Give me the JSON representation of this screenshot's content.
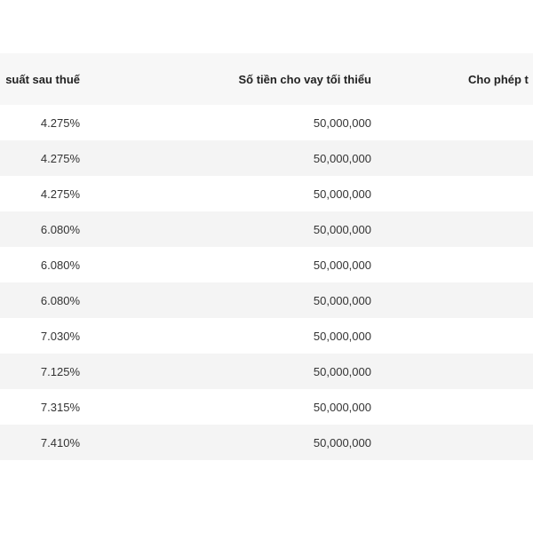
{
  "table": {
    "headers": {
      "rate": "suất sau thuế",
      "min_amount": "Số tiền cho vay tối thiểu",
      "allow": "Cho phép t"
    },
    "rows": [
      {
        "rate": "4.275%",
        "min_amount": "50,000,000"
      },
      {
        "rate": "4.275%",
        "min_amount": "50,000,000"
      },
      {
        "rate": "4.275%",
        "min_amount": "50,000,000"
      },
      {
        "rate": "6.080%",
        "min_amount": "50,000,000"
      },
      {
        "rate": "6.080%",
        "min_amount": "50,000,000"
      },
      {
        "rate": "6.080%",
        "min_amount": "50,000,000"
      },
      {
        "rate": "7.030%",
        "min_amount": "50,000,000"
      },
      {
        "rate": "7.125%",
        "min_amount": "50,000,000"
      },
      {
        "rate": "7.315%",
        "min_amount": "50,000,000"
      },
      {
        "rate": "7.410%",
        "min_amount": "50,000,000"
      }
    ]
  },
  "colors": {
    "header_bg": "#f7f7f7",
    "row_alt_bg": "#f4f4f4",
    "text": "#333333"
  }
}
